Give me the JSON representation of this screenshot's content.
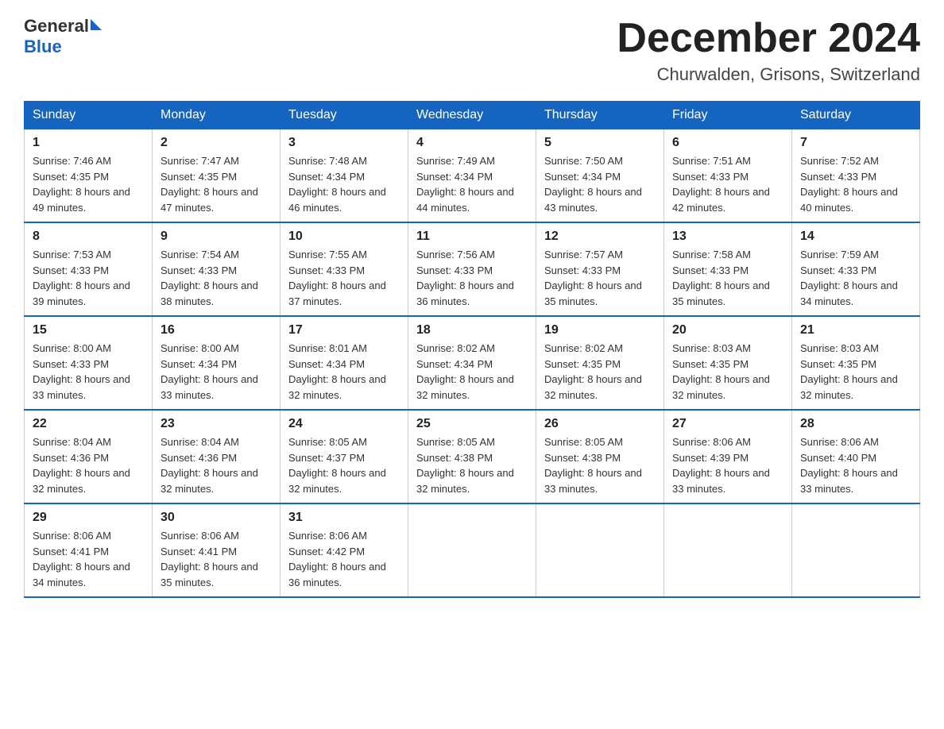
{
  "header": {
    "logo_general": "General",
    "logo_blue": "Blue",
    "month_title": "December 2024",
    "subtitle": "Churwalden, Grisons, Switzerland"
  },
  "days_of_week": [
    "Sunday",
    "Monday",
    "Tuesday",
    "Wednesday",
    "Thursday",
    "Friday",
    "Saturday"
  ],
  "weeks": [
    [
      {
        "day": "1",
        "sunrise": "7:46 AM",
        "sunset": "4:35 PM",
        "daylight": "8 hours and 49 minutes."
      },
      {
        "day": "2",
        "sunrise": "7:47 AM",
        "sunset": "4:35 PM",
        "daylight": "8 hours and 47 minutes."
      },
      {
        "day": "3",
        "sunrise": "7:48 AM",
        "sunset": "4:34 PM",
        "daylight": "8 hours and 46 minutes."
      },
      {
        "day": "4",
        "sunrise": "7:49 AM",
        "sunset": "4:34 PM",
        "daylight": "8 hours and 44 minutes."
      },
      {
        "day": "5",
        "sunrise": "7:50 AM",
        "sunset": "4:34 PM",
        "daylight": "8 hours and 43 minutes."
      },
      {
        "day": "6",
        "sunrise": "7:51 AM",
        "sunset": "4:33 PM",
        "daylight": "8 hours and 42 minutes."
      },
      {
        "day": "7",
        "sunrise": "7:52 AM",
        "sunset": "4:33 PM",
        "daylight": "8 hours and 40 minutes."
      }
    ],
    [
      {
        "day": "8",
        "sunrise": "7:53 AM",
        "sunset": "4:33 PM",
        "daylight": "8 hours and 39 minutes."
      },
      {
        "day": "9",
        "sunrise": "7:54 AM",
        "sunset": "4:33 PM",
        "daylight": "8 hours and 38 minutes."
      },
      {
        "day": "10",
        "sunrise": "7:55 AM",
        "sunset": "4:33 PM",
        "daylight": "8 hours and 37 minutes."
      },
      {
        "day": "11",
        "sunrise": "7:56 AM",
        "sunset": "4:33 PM",
        "daylight": "8 hours and 36 minutes."
      },
      {
        "day": "12",
        "sunrise": "7:57 AM",
        "sunset": "4:33 PM",
        "daylight": "8 hours and 35 minutes."
      },
      {
        "day": "13",
        "sunrise": "7:58 AM",
        "sunset": "4:33 PM",
        "daylight": "8 hours and 35 minutes."
      },
      {
        "day": "14",
        "sunrise": "7:59 AM",
        "sunset": "4:33 PM",
        "daylight": "8 hours and 34 minutes."
      }
    ],
    [
      {
        "day": "15",
        "sunrise": "8:00 AM",
        "sunset": "4:33 PM",
        "daylight": "8 hours and 33 minutes."
      },
      {
        "day": "16",
        "sunrise": "8:00 AM",
        "sunset": "4:34 PM",
        "daylight": "8 hours and 33 minutes."
      },
      {
        "day": "17",
        "sunrise": "8:01 AM",
        "sunset": "4:34 PM",
        "daylight": "8 hours and 32 minutes."
      },
      {
        "day": "18",
        "sunrise": "8:02 AM",
        "sunset": "4:34 PM",
        "daylight": "8 hours and 32 minutes."
      },
      {
        "day": "19",
        "sunrise": "8:02 AM",
        "sunset": "4:35 PM",
        "daylight": "8 hours and 32 minutes."
      },
      {
        "day": "20",
        "sunrise": "8:03 AM",
        "sunset": "4:35 PM",
        "daylight": "8 hours and 32 minutes."
      },
      {
        "day": "21",
        "sunrise": "8:03 AM",
        "sunset": "4:35 PM",
        "daylight": "8 hours and 32 minutes."
      }
    ],
    [
      {
        "day": "22",
        "sunrise": "8:04 AM",
        "sunset": "4:36 PM",
        "daylight": "8 hours and 32 minutes."
      },
      {
        "day": "23",
        "sunrise": "8:04 AM",
        "sunset": "4:36 PM",
        "daylight": "8 hours and 32 minutes."
      },
      {
        "day": "24",
        "sunrise": "8:05 AM",
        "sunset": "4:37 PM",
        "daylight": "8 hours and 32 minutes."
      },
      {
        "day": "25",
        "sunrise": "8:05 AM",
        "sunset": "4:38 PM",
        "daylight": "8 hours and 32 minutes."
      },
      {
        "day": "26",
        "sunrise": "8:05 AM",
        "sunset": "4:38 PM",
        "daylight": "8 hours and 33 minutes."
      },
      {
        "day": "27",
        "sunrise": "8:06 AM",
        "sunset": "4:39 PM",
        "daylight": "8 hours and 33 minutes."
      },
      {
        "day": "28",
        "sunrise": "8:06 AM",
        "sunset": "4:40 PM",
        "daylight": "8 hours and 33 minutes."
      }
    ],
    [
      {
        "day": "29",
        "sunrise": "8:06 AM",
        "sunset": "4:41 PM",
        "daylight": "8 hours and 34 minutes."
      },
      {
        "day": "30",
        "sunrise": "8:06 AM",
        "sunset": "4:41 PM",
        "daylight": "8 hours and 35 minutes."
      },
      {
        "day": "31",
        "sunrise": "8:06 AM",
        "sunset": "4:42 PM",
        "daylight": "8 hours and 36 minutes."
      },
      null,
      null,
      null,
      null
    ]
  ]
}
